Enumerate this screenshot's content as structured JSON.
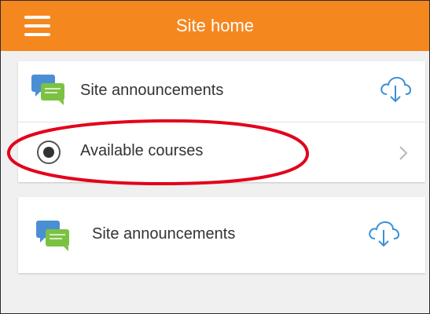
{
  "header": {
    "title": "Site home",
    "menu_icon": "hamburger-menu-icon",
    "color": "#f5871f"
  },
  "card_top": {
    "items": [
      {
        "label": "Site announcements",
        "icon": "forum-chat-icon",
        "action_icon": "cloud-download-icon"
      },
      {
        "label": "Available courses",
        "icon": "radio-dot-icon",
        "action_icon": "chevron-right-icon"
      }
    ]
  },
  "card_bottom": {
    "items": [
      {
        "label": "Site announcements",
        "icon": "forum-chat-icon",
        "action_icon": "cloud-download-icon"
      }
    ]
  },
  "annotation": {
    "type": "ellipse",
    "color": "#e3001b",
    "highlights": "Available courses"
  },
  "colors": {
    "accent": "#f5871f",
    "download_icon": "#3a8fd8",
    "chat_back": "#4a8fd6",
    "chat_front": "#7cc242"
  }
}
